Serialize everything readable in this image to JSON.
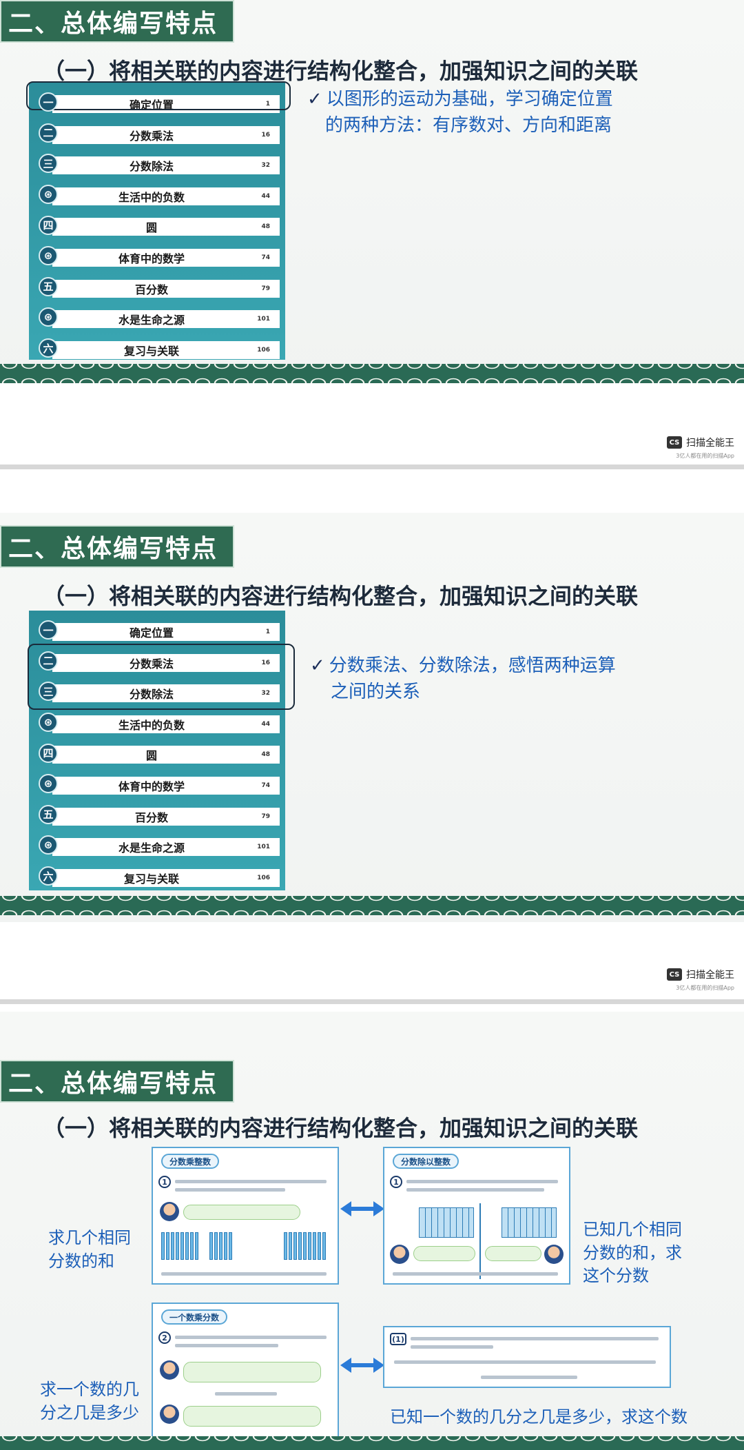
{
  "slide_title": "二、总体编写特点",
  "subtitle": "（一）将相关联的内容进行结构化整合，加强知识之间的关联",
  "toc": [
    {
      "badge": "一",
      "label": "确定位置",
      "page": "1"
    },
    {
      "badge": "二",
      "label": "分数乘法",
      "page": "16"
    },
    {
      "badge": "三",
      "label": "分数除法",
      "page": "32"
    },
    {
      "badge": "⊛",
      "label": "生活中的负数",
      "page": "44"
    },
    {
      "badge": "四",
      "label": "圆",
      "page": "48"
    },
    {
      "badge": "⊛",
      "label": "体育中的数学",
      "page": "74"
    },
    {
      "badge": "五",
      "label": "百分数",
      "page": "79"
    },
    {
      "badge": "⊛",
      "label": "水是生命之源",
      "page": "101"
    },
    {
      "badge": "六",
      "label": "复习与关联",
      "page": "106"
    }
  ],
  "slide1": {
    "note_line1": "以图形的运动为基础，学习确定位置",
    "note_line2": "的两种方法：有序数对、方向和距离"
  },
  "slide2": {
    "note_line1": "分数乘法、分数除法，感悟两种运算",
    "note_line2": "之间的关系"
  },
  "check_mark": "✓",
  "watermark": {
    "logo": "CS",
    "name": "扫描全能王",
    "sub": "3亿人都在用的扫描App"
  },
  "slide3": {
    "card1_tag": "分数乘整数",
    "card2_tag": "分数除以整数",
    "card3_tag": "一个数乘分数",
    "left_top_line1": "求几个相同",
    "left_top_line2": "分数的和",
    "right_top_line1": "已知几个相同",
    "right_top_line2": "分数的和，求",
    "right_top_line3": "这个分数",
    "left_bottom_line1": "求一个数的几",
    "left_bottom_line2": "分之几是多少",
    "right_bottom": "已知一个数的几分之几是多少，求这个数",
    "card1_q": "1",
    "card2_q": "1",
    "card3_q": "2",
    "card4_q": "(1)"
  }
}
